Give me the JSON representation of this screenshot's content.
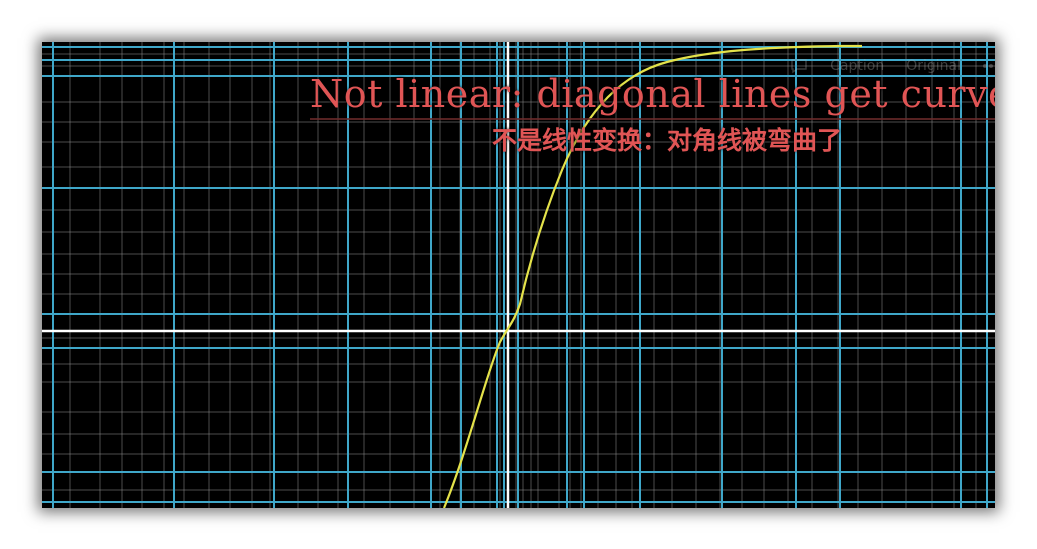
{
  "player": {
    "caption_label": "Caption",
    "original_label": "Original",
    "comment_icon": "comment-icon",
    "more_icon": "more-icon"
  },
  "subtitles": {
    "english": "Not linear: diagonal lines get curved",
    "chinese": "不是线性变换：对角线被弯曲了"
  },
  "colors": {
    "background": "#000000",
    "grid_fine": "#8a8a8a",
    "grid_main": "#3fa7c9",
    "axis": "#ffffff",
    "curve": "#e4e24a",
    "subtitle": "#e05555"
  }
}
